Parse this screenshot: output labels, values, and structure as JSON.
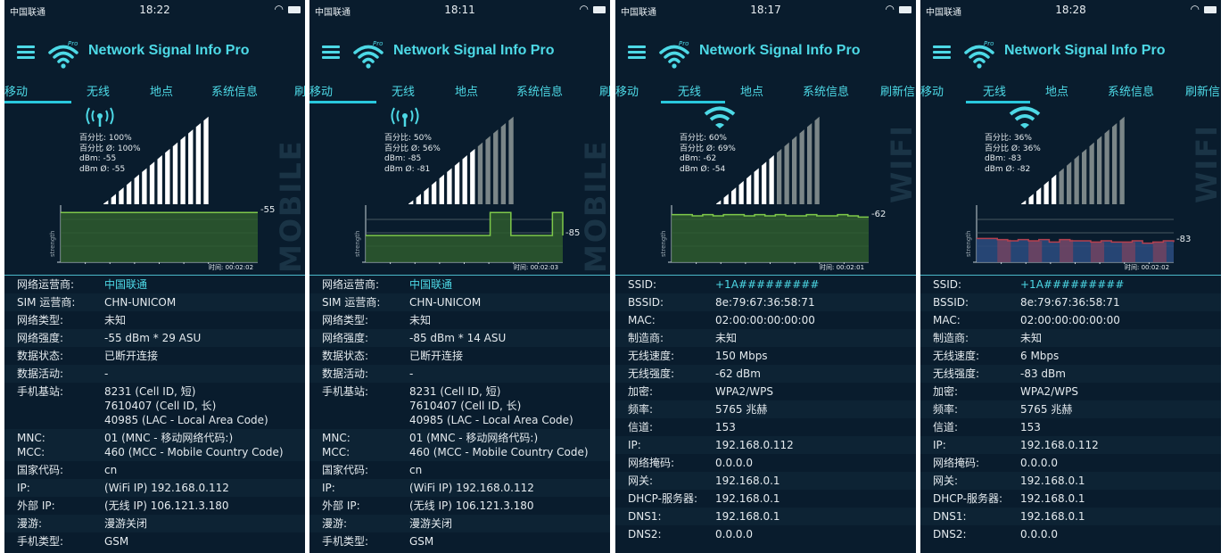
{
  "colors": {
    "bg": "#091c2d",
    "accent": "#4dd9e6",
    "bar_white": "#ffffff",
    "bar_grey": "#7b8688",
    "chart_green": "#7fc94a",
    "chart_fill": "#2e5a2e",
    "chart_red": "#b5404f",
    "chart_blue": "#2a4a7c"
  },
  "screens": [
    {
      "status": {
        "carrier": "中国联通",
        "time": "18:22"
      },
      "app_title": "Network Signal Info Pro",
      "tabs": [
        {
          "label": "移动"
        },
        {
          "label": "无线"
        },
        {
          "label": "地点"
        },
        {
          "label": "系统信息"
        },
        {
          "label": "刷"
        }
      ],
      "active_tab": 0,
      "icon": "signal-tower-icon",
      "signal": {
        "pct": "百分比: 100%",
        "pct_avg": "百分比 Ø:  100%",
        "dbm": "dBm: -55",
        "dbm_avg": "dBm Ø:  -55",
        "bars_filled": 14,
        "bars_total": 14
      },
      "watermark": "MOBILE",
      "chart": {
        "end_value": "-55",
        "time": "时间: 00:02:02",
        "values": [
          -55,
          -55,
          -55,
          -55,
          -55,
          -55,
          -55,
          -55,
          -55,
          -55,
          -55,
          -55,
          -55,
          -55,
          -55,
          -55,
          -55,
          -55,
          -55,
          -55
        ],
        "ymin": -120,
        "ymax": -50,
        "mode": "green"
      },
      "rows": [
        {
          "k": "网络运营商:",
          "v": "中国联通",
          "accent": true
        },
        {
          "k": "SIM 运营商:",
          "v": "CHN-UNICOM"
        },
        {
          "k": "网络类型:",
          "v": "未知"
        },
        {
          "k": "网络强度:",
          "v": "-55 dBm * 29 ASU"
        },
        {
          "k": "数据状态:",
          "v": "已断开连接"
        },
        {
          "k": "数据活动:",
          "v": "-"
        },
        {
          "k": "手机基站:",
          "v": "8231 (Cell ID, 短)\n7610407 (Cell ID, 长)\n40985 (LAC - Local Area Code)"
        },
        {
          "k": "MNC:\nMCC:",
          "v": "01 (MNC - 移动网络代码:)\n460 (MCC - Mobile Country Code)"
        },
        {
          "k": "国家代码:",
          "v": "cn"
        },
        {
          "k": "IP:",
          "v": "(WiFi IP) 192.168.0.112"
        },
        {
          "k": "外部 IP:",
          "v": "(无线 IP) 106.121.3.180"
        },
        {
          "k": "漫游:",
          "v": "漫游关闭"
        },
        {
          "k": "手机类型:",
          "v": "GSM"
        }
      ]
    },
    {
      "status": {
        "carrier": "中国联通",
        "time": "18:11"
      },
      "app_title": "Network Signal Info Pro",
      "tabs": [
        {
          "label": "移动"
        },
        {
          "label": "无线"
        },
        {
          "label": "地点"
        },
        {
          "label": "系统信息"
        },
        {
          "label": "刷"
        }
      ],
      "active_tab": 0,
      "icon": "signal-tower-icon",
      "signal": {
        "pct": "百分比: 50%",
        "pct_avg": "百分比 Ø:  56%",
        "dbm": "dBm: -85",
        "dbm_avg": "dBm Ø:  -81",
        "bars_filled": 9,
        "bars_total": 14
      },
      "watermark": "MOBILE",
      "chart": {
        "end_value": "-85",
        "time": "时间: 00:02:03",
        "values": [
          -85,
          -85,
          -85,
          -85,
          -85,
          -85,
          -85,
          -85,
          -85,
          -85,
          -85,
          -85,
          -55,
          -55,
          -85,
          -85,
          -85,
          -85,
          -55,
          -85
        ],
        "ymin": -120,
        "ymax": -50,
        "mode": "green"
      },
      "rows": [
        {
          "k": "网络运营商:",
          "v": "中国联通",
          "accent": true
        },
        {
          "k": "SIM 运营商:",
          "v": "CHN-UNICOM"
        },
        {
          "k": "网络类型:",
          "v": "未知"
        },
        {
          "k": "网络强度:",
          "v": "-85 dBm * 14 ASU"
        },
        {
          "k": "数据状态:",
          "v": "已断开连接"
        },
        {
          "k": "数据活动:",
          "v": "-"
        },
        {
          "k": "手机基站:",
          "v": "8231 (Cell ID, 短)\n7610407 (Cell ID, 长)\n40985 (LAC - Local Area Code)"
        },
        {
          "k": "MNC:\nMCC:",
          "v": "01 (MNC - 移动网络代码:)\n460 (MCC - Mobile Country Code)"
        },
        {
          "k": "国家代码:",
          "v": "cn"
        },
        {
          "k": "IP:",
          "v": "(WiFi IP) 192.168.0.112"
        },
        {
          "k": "外部 IP:",
          "v": "(无线 IP) 106.121.3.180"
        },
        {
          "k": "漫游:",
          "v": "漫游关闭"
        },
        {
          "k": "手机类型:",
          "v": "GSM"
        }
      ]
    },
    {
      "status": {
        "carrier": "中国联通",
        "time": "18:17"
      },
      "app_title": "Network Signal Info Pro",
      "tabs": [
        {
          "label": "移动"
        },
        {
          "label": "无线"
        },
        {
          "label": "地点"
        },
        {
          "label": "系统信息"
        },
        {
          "label": "刷新信"
        }
      ],
      "active_tab": 1,
      "icon": "wifi-icon",
      "signal": {
        "pct": "百分比: 60%",
        "pct_avg": "百分比 Ø:  69%",
        "dbm": "dBm:  -62",
        "dbm_avg": "dBm Ø:  -54",
        "bars_filled": 8,
        "bars_total": 14
      },
      "watermark": "WIFI",
      "chart": {
        "end_value": "-62",
        "time": "时间: 00:02:01",
        "values": [
          -60,
          -60,
          -61,
          -60,
          -61,
          -60,
          -60,
          -61,
          -60,
          -61,
          -60,
          -61,
          -61,
          -60,
          -61,
          -61,
          -60,
          -61,
          -62,
          -62
        ],
        "ymin": -100,
        "ymax": -55,
        "mode": "green"
      },
      "rows": [
        {
          "k": "SSID:",
          "v": "+1A#########",
          "accent": true
        },
        {
          "k": "BSSID:",
          "v": "8e:79:67:36:58:71"
        },
        {
          "k": "MAC:",
          "v": "02:00:00:00:00:00"
        },
        {
          "k": "制造商:",
          "v": "未知"
        },
        {
          "k": "无线速度:",
          "v": "150 Mbps"
        },
        {
          "k": "无线强度:",
          "v": "-62 dBm"
        },
        {
          "k": "加密:",
          "v": "WPA2/WPS"
        },
        {
          "k": "频率:",
          "v": "5765 兆赫"
        },
        {
          "k": "信道:",
          "v": "153"
        },
        {
          "k": "IP:",
          "v": "192.168.0.112"
        },
        {
          "k": "网络掩码:",
          "v": "0.0.0.0"
        },
        {
          "k": "网关:",
          "v": "192.168.0.1"
        },
        {
          "k": "DHCP-服务器:",
          "v": "192.168.0.1"
        },
        {
          "k": "DNS1:",
          "v": "192.168.0.1"
        },
        {
          "k": "DNS2:",
          "v": "0.0.0.0"
        }
      ]
    },
    {
      "status": {
        "carrier": "中国联通",
        "time": "18:28"
      },
      "app_title": "Network Signal Info Pro",
      "tabs": [
        {
          "label": "移动"
        },
        {
          "label": "无线"
        },
        {
          "label": "地点"
        },
        {
          "label": "系统信息"
        },
        {
          "label": "刷新信"
        }
      ],
      "active_tab": 1,
      "icon": "wifi-icon",
      "signal": {
        "pct": "百分比: 36%",
        "pct_avg": "百分比 Ø:  36%",
        "dbm": "dBm:  -83",
        "dbm_avg": "dBm Ø:  -82",
        "bars_filled": 5,
        "bars_total": 14
      },
      "watermark": "WIFI",
      "chart": {
        "end_value": "-83",
        "time": "时间: 00:02:02",
        "values": [
          -80,
          -80,
          -81,
          -82,
          -81,
          -82,
          -81,
          -83,
          -81,
          -82,
          -82,
          -83,
          -82,
          -83,
          -83,
          -82,
          -84,
          -83,
          -82,
          -83
        ],
        "ymin": -100,
        "ymax": -55,
        "mode": "redblue"
      },
      "rows": [
        {
          "k": "SSID:",
          "v": "+1A#########",
          "accent": true
        },
        {
          "k": "BSSID:",
          "v": "8e:79:67:36:58:71"
        },
        {
          "k": "MAC:",
          "v": "02:00:00:00:00:00"
        },
        {
          "k": "制造商:",
          "v": "未知"
        },
        {
          "k": "无线速度:",
          "v": "6 Mbps"
        },
        {
          "k": "无线强度:",
          "v": "-83 dBm"
        },
        {
          "k": "加密:",
          "v": "WPA2/WPS"
        },
        {
          "k": "频率:",
          "v": "5765 兆赫"
        },
        {
          "k": "信道:",
          "v": "153"
        },
        {
          "k": "IP:",
          "v": "192.168.0.112"
        },
        {
          "k": "网络掩码:",
          "v": "0.0.0.0"
        },
        {
          "k": "网关:",
          "v": "192.168.0.1"
        },
        {
          "k": "DHCP-服务器:",
          "v": "192.168.0.1"
        },
        {
          "k": "DNS1:",
          "v": "192.168.0.1"
        },
        {
          "k": "DNS2:",
          "v": "0.0.0.0"
        }
      ]
    }
  ]
}
